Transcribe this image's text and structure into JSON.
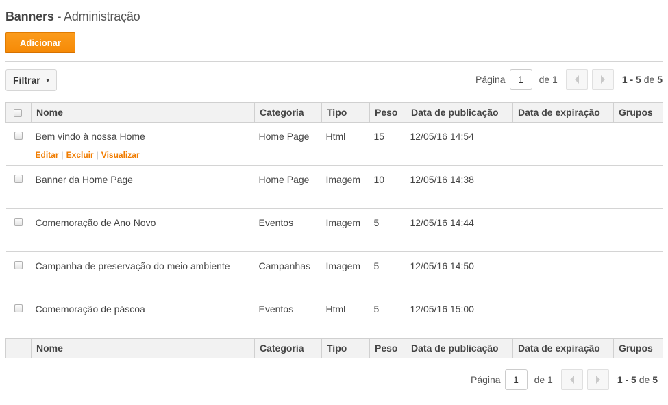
{
  "header": {
    "title_strong": "Banners",
    "title_rest": " - Administração"
  },
  "toolbar": {
    "add_label": "Adicionar",
    "filter_label": "Filtrar"
  },
  "pagination": {
    "page_label": "Página",
    "current_page": "1",
    "of_label": "de 1",
    "range": "1 - 5",
    "range_of": " de ",
    "total": "5"
  },
  "table": {
    "columns": [
      "Nome",
      "Categoria",
      "Tipo",
      "Peso",
      "Data de publicação",
      "Data de expiração",
      "Grupos"
    ],
    "rows": [
      {
        "nome": "Bem vindo à nossa Home",
        "categoria": "Home Page",
        "tipo": "Html",
        "peso": "15",
        "publicacao": "12/05/16 14:54",
        "expiracao": "",
        "grupos": ""
      },
      {
        "nome": "Banner da Home Page",
        "categoria": "Home Page",
        "tipo": "Imagem",
        "peso": "10",
        "publicacao": "12/05/16 14:38",
        "expiracao": "",
        "grupos": ""
      },
      {
        "nome": "Comemoração de Ano Novo",
        "categoria": "Eventos",
        "tipo": "Imagem",
        "peso": "5",
        "publicacao": "12/05/16 14:44",
        "expiracao": "",
        "grupos": ""
      },
      {
        "nome": "Campanha de preservação do meio ambiente",
        "categoria": "Campanhas",
        "tipo": "Imagem",
        "peso": "5",
        "publicacao": "12/05/16 14:50",
        "expiracao": "",
        "grupos": ""
      },
      {
        "nome": "Comemoração de páscoa",
        "categoria": "Eventos",
        "tipo": "Html",
        "peso": "5",
        "publicacao": "12/05/16 15:00",
        "expiracao": "",
        "grupos": ""
      }
    ],
    "row_actions": {
      "edit": "Editar",
      "delete": "Excluir",
      "view": "Visualizar",
      "separator": "|"
    }
  },
  "colors": {
    "accent": "#f68a06",
    "link": "#f07c00"
  },
  "icons": {
    "prev": "triangle-left-icon",
    "next": "triangle-right-icon",
    "dropdown": "caret-down-icon"
  }
}
